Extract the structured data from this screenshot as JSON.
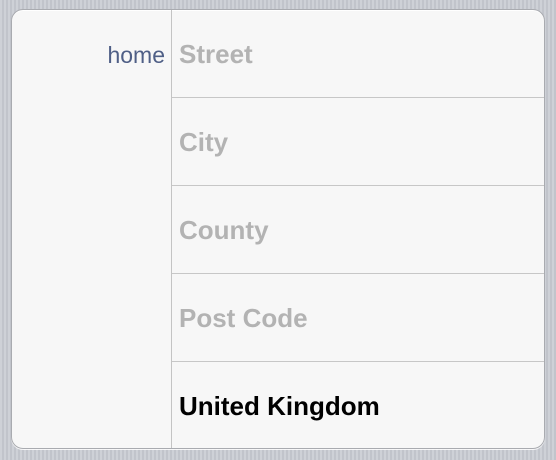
{
  "address_card": {
    "label": "home",
    "fields": [
      {
        "placeholder": "Street",
        "value": ""
      },
      {
        "placeholder": "City",
        "value": ""
      },
      {
        "placeholder": "County",
        "value": ""
      },
      {
        "placeholder": "Post Code",
        "value": ""
      },
      {
        "placeholder": "",
        "value": "United Kingdom"
      }
    ]
  },
  "colors": {
    "label_text": "#4f5f86",
    "placeholder_text": "#b3b3b3",
    "value_text": "#000000",
    "card_background": "#f7f7f7",
    "page_background": "#c9ccd3"
  }
}
